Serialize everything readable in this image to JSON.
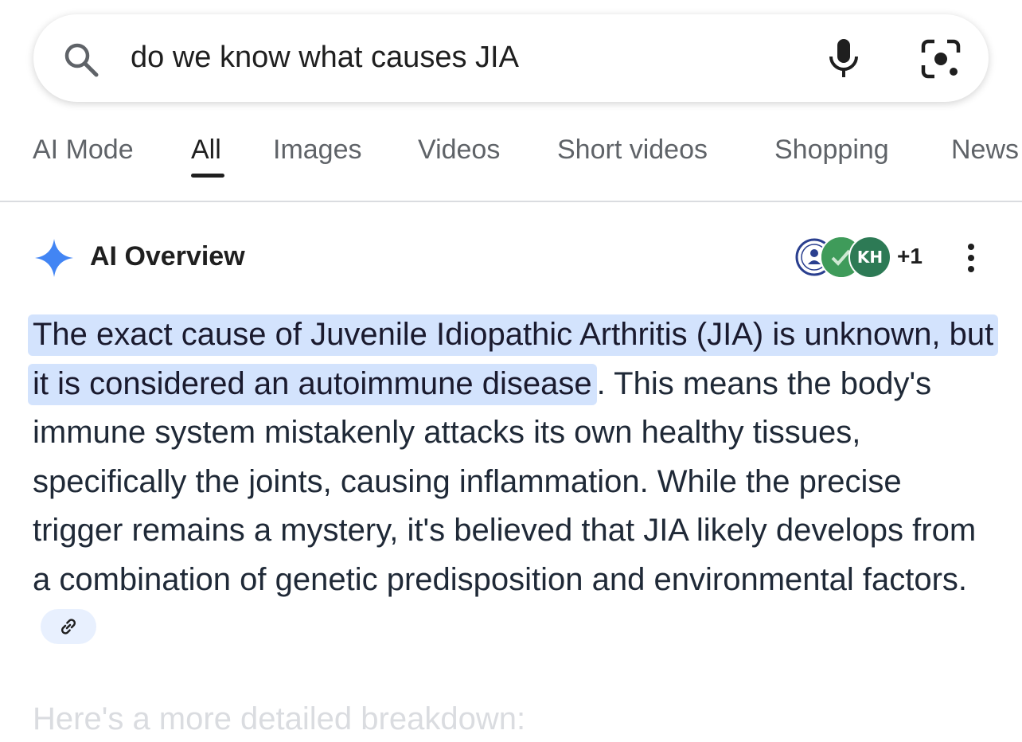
{
  "search": {
    "query": "do we know what causes JIA",
    "icons": [
      "search-icon",
      "mic-icon",
      "lens-icon"
    ]
  },
  "tabs": [
    {
      "label": "AI Mode",
      "active": false
    },
    {
      "label": "All",
      "active": true
    },
    {
      "label": "Images",
      "active": false
    },
    {
      "label": "Videos",
      "active": false
    },
    {
      "label": "Short videos",
      "active": false
    },
    {
      "label": "Shopping",
      "active": false
    },
    {
      "label": "News",
      "active": false
    }
  ],
  "ai_overview": {
    "title": "AI Overview",
    "sources_badge": "KH",
    "extra_sources": "+1",
    "highlight_text": "The exact cause of Juvenile Idiopathic Arthritis (JIA) is unknown, but it is considered an autoimmune disease",
    "period": ".",
    "body_text": " This means the body's immune system mistakenly attacks its own healthy tissues, specifically the joints, causing inflammation. While the precise trigger remains a mystery, it's believed that JIA likely develops from a combination of genetic predisposition and environmental factors.",
    "next_heading": "Here's a more detailed breakdown:"
  },
  "colors": {
    "accent_blue": "#4285f4",
    "highlight": "#d3e3fd",
    "chip_bg": "#e8f0fe"
  }
}
